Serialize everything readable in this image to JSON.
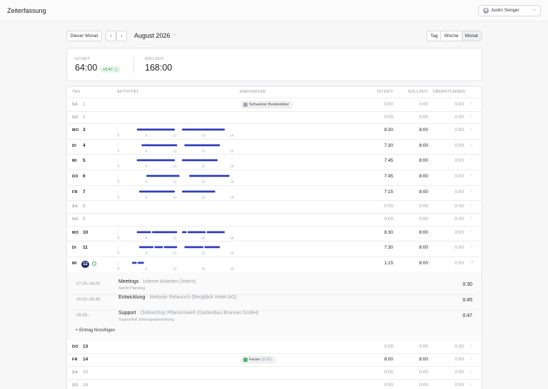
{
  "app_title": "Zeiterfassung",
  "user": {
    "name": "Justin Senger"
  },
  "toolbar": {
    "this_month": "Dieser Monat",
    "month": "August 2026",
    "views": [
      "Tag",
      "Woche",
      "Monat"
    ],
    "active_view": "Monat"
  },
  "summary": {
    "ist_label": "ISTZEIT",
    "ist_value": "64:00",
    "ist_delta": "+0:47",
    "soll_label": "SOLLZEIT",
    "soll_value": "168:00"
  },
  "columns": {
    "day": "TAG",
    "activity": "AKTIVITÄT",
    "events": "EREIGNISSE",
    "ist": "ISTZEIT",
    "soll": "SOLLZEIT",
    "ueber": "ÜBERSTUNDEN"
  },
  "timeline_ticks": [
    "6",
    "9",
    "12",
    "15",
    "18"
  ],
  "rows": [
    {
      "wd": "SA",
      "day": "1",
      "ist": "0:00",
      "soll": "0:00",
      "ueber": "0:00",
      "weekend": true,
      "event": {
        "label": "Schweizer Bundesfeier",
        "sub": ""
      }
    },
    {
      "wd": "SO",
      "day": "2",
      "ist": "0:00",
      "soll": "0:00",
      "ueber": "0:00",
      "weekend": true
    },
    {
      "wd": "MO",
      "day": "3",
      "ist": "8:30",
      "soll": "8:00",
      "ueber": "0:00",
      "bars": [
        [
          8.0,
          12.0
        ],
        [
          12.75,
          17.25
        ]
      ]
    },
    {
      "wd": "DI",
      "day": "4",
      "ist": "7:30",
      "soll": "8:00",
      "ueber": "0:00",
      "bars": [
        [
          8.5,
          12.25
        ],
        [
          13.0,
          16.75
        ]
      ]
    },
    {
      "wd": "MI",
      "day": "5",
      "ist": "7:45",
      "soll": "8:00",
      "ueber": "0:00",
      "bars": [
        [
          8.0,
          12.0
        ],
        [
          12.75,
          16.5
        ]
      ]
    },
    {
      "wd": "DO",
      "day": "6",
      "ist": "7:45",
      "soll": "8:00",
      "ueber": "0:00",
      "bars": [
        [
          9.0,
          12.5
        ],
        [
          13.5,
          17.75
        ]
      ]
    },
    {
      "wd": "FR",
      "day": "7",
      "ist": "7:15",
      "soll": "8:00",
      "ueber": "0:00",
      "bars": [
        [
          8.25,
          12.0
        ],
        [
          12.75,
          16.25
        ]
      ]
    },
    {
      "wd": "SA",
      "day": "8",
      "ist": "0:00",
      "soll": "0:00",
      "ueber": "0:00",
      "weekend": true
    },
    {
      "wd": "SO",
      "day": "9",
      "ist": "0:00",
      "soll": "0:00",
      "ueber": "0:00",
      "weekend": true
    },
    {
      "wd": "MO",
      "day": "10",
      "ist": "8:30",
      "soll": "8:00",
      "ueber": "0:00",
      "bars": [
        [
          8.0,
          9.5
        ],
        [
          9.6,
          12.25
        ],
        [
          12.75,
          13.25
        ],
        [
          13.35,
          15.25
        ],
        [
          15.35,
          17.25
        ]
      ]
    },
    {
      "wd": "DI",
      "day": "11",
      "ist": "7:30",
      "soll": "8:00",
      "ueber": "0:00",
      "bars": [
        [
          8.25,
          9.75
        ],
        [
          9.85,
          10.75
        ],
        [
          10.85,
          12.25
        ],
        [
          13.0,
          15.0
        ],
        [
          15.1,
          16.75
        ]
      ]
    },
    {
      "wd": "MI",
      "day": "12",
      "ist": "1:15",
      "soll": "8:00",
      "ueber": "0:00",
      "today": true,
      "bars": [
        [
          7.5,
          8.0
        ],
        [
          8.1,
          8.75
        ]
      ]
    },
    {
      "wd": "DO",
      "day": "13",
      "ist": "0:00",
      "soll": "0:00",
      "ueber": "0:00"
    },
    {
      "wd": "FR",
      "day": "14",
      "ist": "8:00",
      "soll": "8:00",
      "ueber": "0:00",
      "event": {
        "label": "Ferien",
        "sub": "(8:00)",
        "green": true
      }
    },
    {
      "wd": "SA",
      "day": "15",
      "ist": "0:00",
      "soll": "0:00",
      "ueber": "0:00",
      "weekend": true
    },
    {
      "wd": "SO",
      "day": "16",
      "ist": "0:00",
      "soll": "0:00",
      "ueber": "0:00",
      "weekend": true
    }
  ],
  "entries": [
    {
      "time": "07:30–08:00",
      "title": "Meetings",
      "project": "Interne Arbeiten (Intern)",
      "desc": "Sprint Planning",
      "duration": "0:30"
    },
    {
      "time": "08:00–08:45",
      "title": "Entwicklung",
      "project": "Website Relaunch (Bergblick Hotel AG)",
      "desc": "",
      "duration": "0:45"
    },
    {
      "time": "08:45–",
      "title": "Support",
      "project": "Onlineshop Pflanzenwelt (Gartenbau Brunner GmbH)",
      "desc": "Supportfall Zahlungsabwicklung",
      "duration": "0:47"
    }
  ],
  "add_entry_label": "Eintrag hinzufügen",
  "colors": {
    "bar": "#2f3db8",
    "today": "#232a6a",
    "positive": "#2e8a45"
  }
}
